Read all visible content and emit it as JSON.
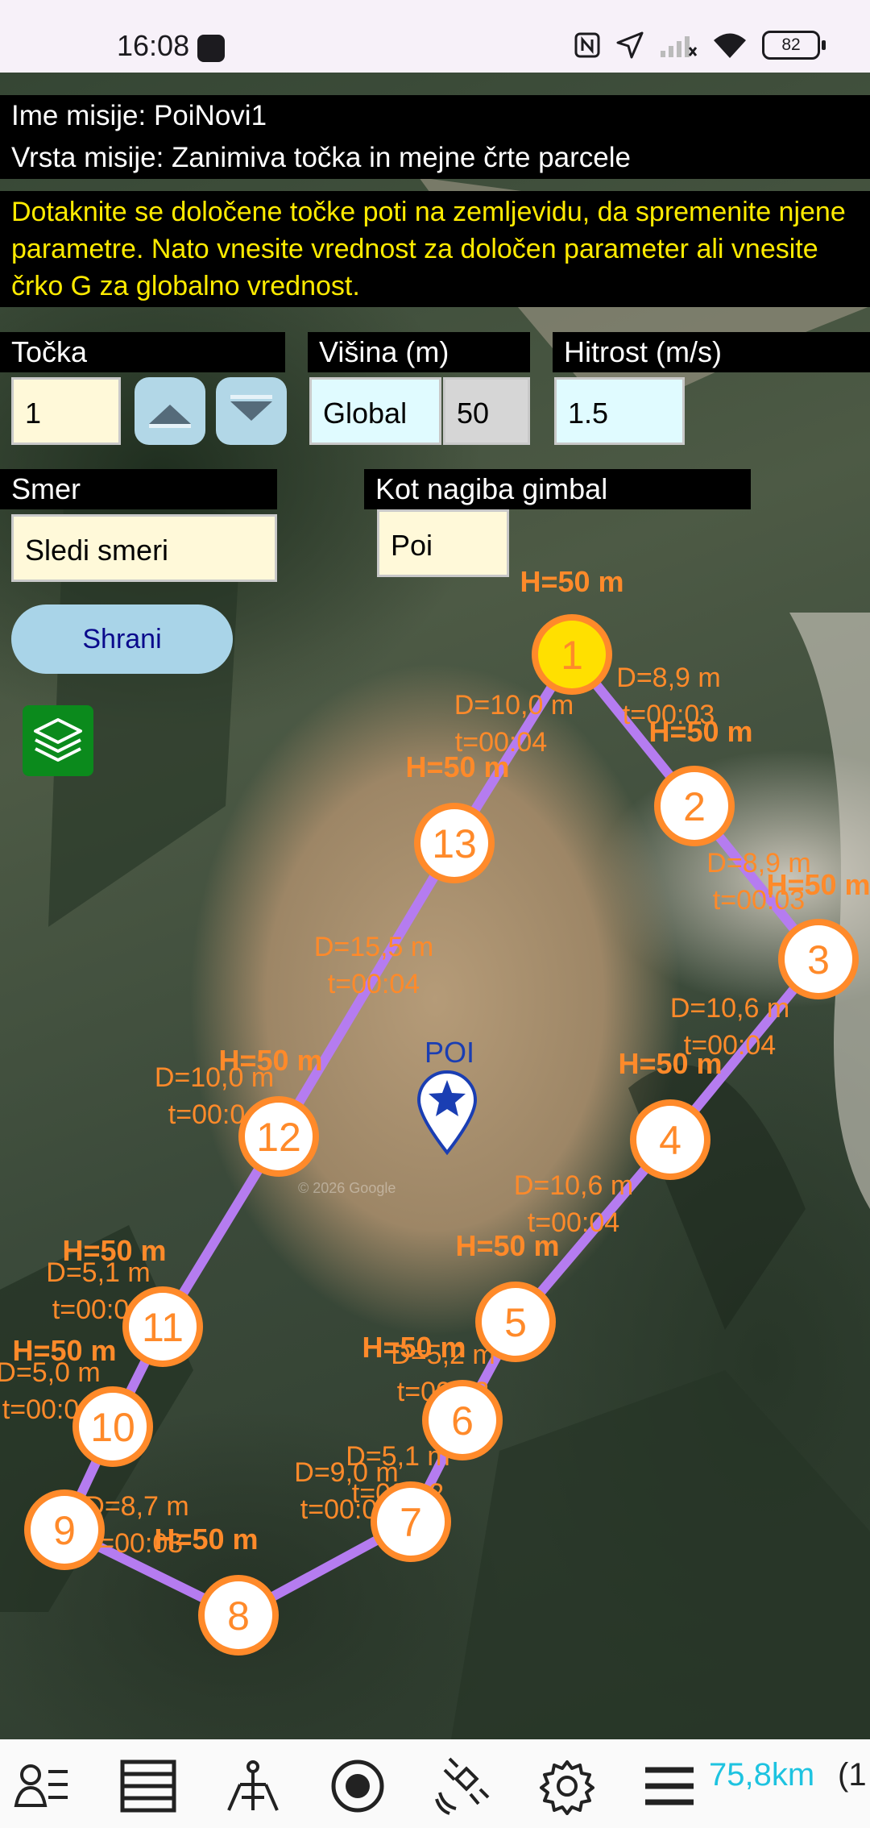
{
  "status_bar": {
    "time": "16:08",
    "battery": "82"
  },
  "mission": {
    "name_line": "Ime misije: PoiNovi1",
    "type_line": "Vrsta misije: Zanimiva točka in mejne črte parcele"
  },
  "instructions": "Dotaknite se določene točke poti na zemljevidu, da spremenite njene parametre. Nato vnesite vrednost za določen parameter ali vnesite črko G za globalno vrednost.",
  "form": {
    "point_label": "Točka",
    "point_value": "1",
    "height_label": "Višina (m)",
    "height_mode": "Global",
    "height_value": "50",
    "speed_label": "Hitrost (m/s)",
    "speed_value": "1.5",
    "heading_label": "Smer",
    "heading_value": "Sledi smeri",
    "gimbal_label": "Kot nagiba gimbal",
    "gimbal_value": "Poi",
    "save_label": "Shrani"
  },
  "map": {
    "poi_label": "POI",
    "watermark": "© 2026 Google",
    "route_color": "#b57cf0",
    "marker_color": "#ff8a2a",
    "selected_color": "#ffe000",
    "waypoints": [
      {
        "id": "1",
        "height": "H=50 m",
        "segment_distance": "D=8,9 m",
        "segment_time": "t=00:03"
      },
      {
        "id": "2",
        "height": "H=50 m",
        "segment_distance": "D=8,9 m",
        "segment_time": "t=00:03"
      },
      {
        "id": "3",
        "height": "H=50 m",
        "segment_distance": "D=10,6 m",
        "segment_time": "t=00:04"
      },
      {
        "id": "4",
        "height": "H=50 m",
        "segment_distance": "D=10,6 m",
        "segment_time": "t=00:04"
      },
      {
        "id": "5",
        "height": "H=50 m",
        "segment_distance": "D=5,2 m",
        "segment_time": "t=00:02"
      },
      {
        "id": "6",
        "height": "H=50 m",
        "segment_distance": "D=5,1 m",
        "segment_time": "t=00:02"
      },
      {
        "id": "7",
        "height": "",
        "segment_distance": "D=9,0 m",
        "segment_time": "t=00:03"
      },
      {
        "id": "8",
        "height": "H=50 m",
        "segment_distance": "",
        "segment_time": ""
      },
      {
        "id": "9",
        "height": "",
        "segment_distance": "D=8,7 m",
        "segment_time": "t=00:03"
      },
      {
        "id": "10",
        "height": "H=50 m",
        "segment_distance": "D=5,0 m",
        "segment_time": "t=00:02"
      },
      {
        "id": "11",
        "height": "H=50 m",
        "segment_distance": "D=5,1 m",
        "segment_time": "t=00:02"
      },
      {
        "id": "12",
        "height": "H=50 m",
        "segment_distance": "D=10,0 m",
        "segment_time": "t=00:04"
      },
      {
        "id": "13",
        "height": "H=50 m",
        "segment_distance": "D=15,5 m",
        "segment_time": "t=00:04"
      }
    ],
    "closing_segment": {
      "distance": "D=10,0 m",
      "time": "t=00:04"
    }
  },
  "bottom_bar": {
    "icons": [
      "person-list-icon",
      "layers-list-icon",
      "drone-home-icon",
      "record-icon",
      "satellite-icon",
      "gear-icon",
      "menu-icon"
    ],
    "distance": "75,8km",
    "distance_extra": "(1"
  }
}
